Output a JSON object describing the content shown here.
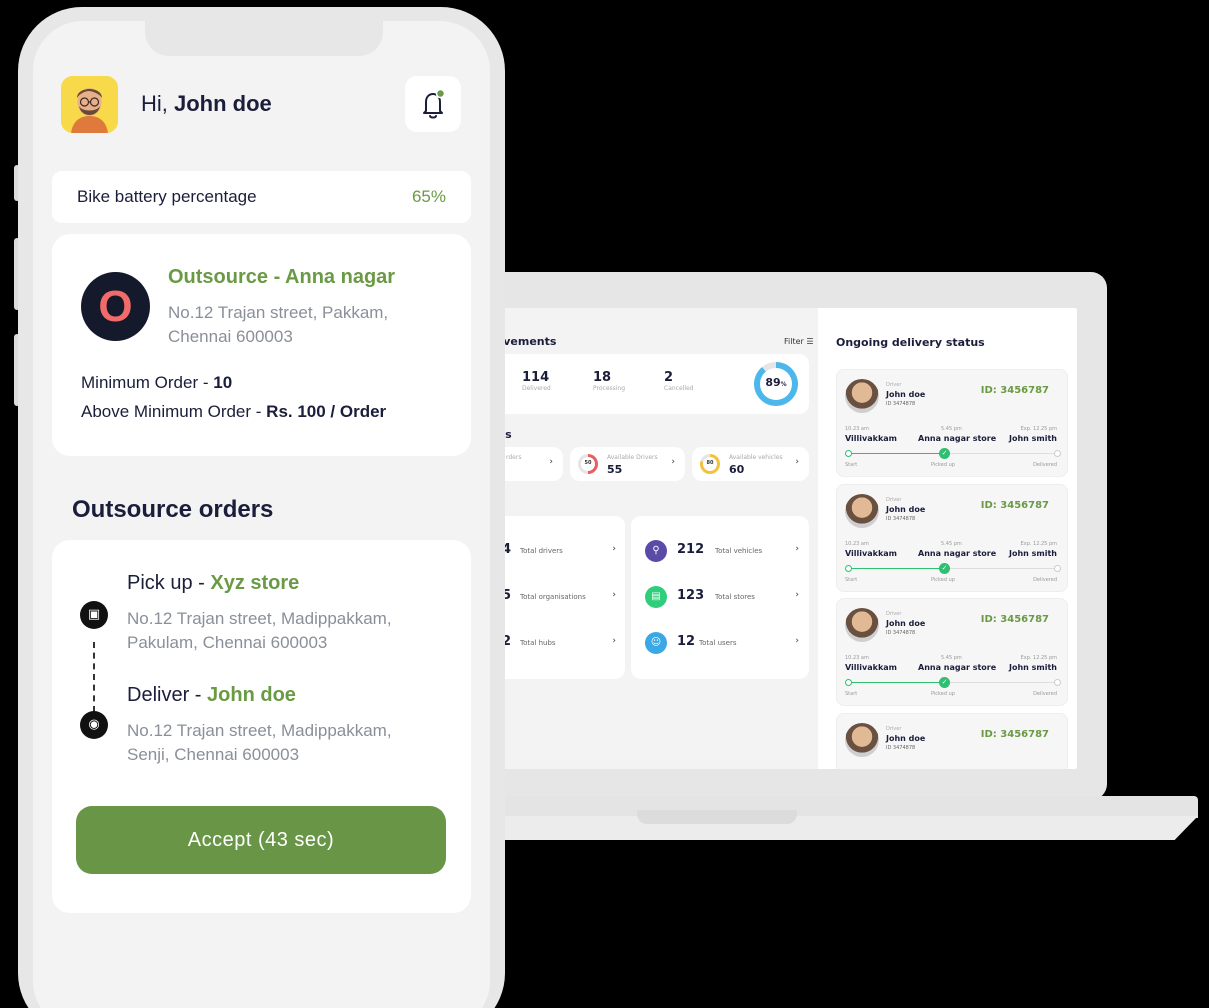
{
  "phone": {
    "greeting_prefix": "Hi, ",
    "user_name": "John doe",
    "battery": {
      "label": "Bike battery percentage",
      "value": "65%"
    },
    "store": {
      "logo_letter": "O",
      "name": "Outsource - Anna nagar",
      "address": "No.12 Trajan street, Pakkam, Chennai 600003",
      "min_order_label": "Minimum Order - ",
      "min_order_value": "10",
      "above_min_label": "Above Minimum Order  - ",
      "above_min_value": "Rs. 100 / Order"
    },
    "section_title": "Outsource orders",
    "pickup": {
      "label": "Pick up - ",
      "name": "Xyz store",
      "address": "No.12 Trajan street, Madippakkam, Pakulam, Chennai 600003"
    },
    "deliver": {
      "label": "Deliver - ",
      "name": "John doe",
      "address": "No.12 Trajan street, Madippakkam, Senji, Chennai 600003"
    },
    "accept_button": "Accept (43 sec)"
  },
  "laptop": {
    "achievements_title": "ievements",
    "filter_label": "Filter",
    "stats": [
      {
        "value": "114",
        "label": "Delivered"
      },
      {
        "value": "18",
        "label": "Processing"
      },
      {
        "value": "2",
        "label": "Cancelled"
      }
    ],
    "ring_value": "89",
    "ring_unit": "%",
    "ring_fraction": 0.89,
    "status_title": "tus",
    "status_cards": [
      {
        "label": "rders",
        "value": ""
      },
      {
        "label": "Available Drivers",
        "value": "55",
        "ring": "50"
      },
      {
        "label": "Available vehicles",
        "value": "60",
        "ring": "80"
      }
    ],
    "totals_left": [
      {
        "num": "4",
        "label": "Total drivers"
      },
      {
        "num": "5",
        "label": "Total organisations"
      },
      {
        "num": "2",
        "label": "Total hubs"
      }
    ],
    "totals_right": [
      {
        "num": "212",
        "label": "Total vehicles"
      },
      {
        "num": "123",
        "label": "Total stores"
      },
      {
        "num": "12",
        "label": "Total users"
      }
    ],
    "ongoing_title": "Ongoing delivery status",
    "deliveries": [
      {
        "role": "Driver",
        "name": "John doe",
        "id_small": "ID 3474878",
        "id": "ID: 3456787",
        "t1": "10.23 am",
        "t2": "5.45 pm",
        "t3": "Exp. 12.25 pm",
        "p1": "Villivakkam",
        "p2": "Anna nagar store",
        "p3": "John smith",
        "s1": "Start",
        "s2": "Picked up",
        "s3": "Delivered"
      },
      {
        "role": "Driver",
        "name": "John doe",
        "id_small": "ID 3474878",
        "id": "ID: 3456787",
        "t1": "10.23 am",
        "t2": "5.45 pm",
        "t3": "Exp. 12.25 pm",
        "p1": "Villivakkam",
        "p2": "Anna nagar store",
        "p3": "John smith",
        "s1": "Start",
        "s2": "Picked up",
        "s3": "Delivered"
      },
      {
        "role": "Driver",
        "name": "John doe",
        "id_small": "ID 3474878",
        "id": "ID: 3456787",
        "t1": "10.23 am",
        "t2": "5.45 pm",
        "t3": "Exp. 12.25 pm",
        "p1": "Villivakkam",
        "p2": "Anna nagar store",
        "p3": "John smith",
        "s1": "Start",
        "s2": "Picked up",
        "s3": "Delivered"
      },
      {
        "role": "Driver",
        "name": "John doe",
        "id_small": "ID 3474878",
        "id": "ID: 3456787"
      }
    ]
  },
  "colors": {
    "accent_green": "#699547",
    "text_green": "#6a9a44",
    "dark": "#1a1e3a",
    "ring_blue": "#4cb7ea"
  }
}
